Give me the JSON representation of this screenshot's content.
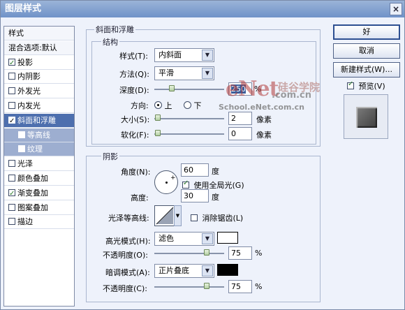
{
  "window": {
    "title": "图层样式",
    "close_glyph": "×"
  },
  "style_list": {
    "items": [
      {
        "label": "样式",
        "checkbox": false,
        "checked": false,
        "kind": "header"
      },
      {
        "label": "混合选项:默认",
        "checkbox": false,
        "checked": false,
        "kind": "header"
      },
      {
        "label": "投影",
        "checkbox": true,
        "checked": true,
        "kind": "item"
      },
      {
        "label": "内阴影",
        "checkbox": true,
        "checked": false,
        "kind": "item"
      },
      {
        "label": "外发光",
        "checkbox": true,
        "checked": false,
        "kind": "item"
      },
      {
        "label": "内发光",
        "checkbox": true,
        "checked": false,
        "kind": "item"
      },
      {
        "label": "斜面和浮雕",
        "checkbox": true,
        "checked": true,
        "kind": "selected"
      },
      {
        "label": "等高线",
        "checkbox": true,
        "checked": false,
        "kind": "sub"
      },
      {
        "label": "纹理",
        "checkbox": true,
        "checked": false,
        "kind": "sub"
      },
      {
        "label": "光泽",
        "checkbox": true,
        "checked": false,
        "kind": "item"
      },
      {
        "label": "颜色叠加",
        "checkbox": true,
        "checked": false,
        "kind": "item"
      },
      {
        "label": "渐变叠加",
        "checkbox": true,
        "checked": true,
        "kind": "item"
      },
      {
        "label": "图案叠加",
        "checkbox": true,
        "checked": false,
        "kind": "item"
      },
      {
        "label": "描边",
        "checkbox": true,
        "checked": false,
        "kind": "item"
      }
    ]
  },
  "bevel": {
    "group_title": "斜面和浮雕",
    "structure_title": "结构",
    "style_label": "样式(T):",
    "style_value": "内斜面",
    "method_label": "方法(Q):",
    "method_value": "平滑",
    "depth_label": "深度(D):",
    "depth_value": "250",
    "depth_unit": "%",
    "depth_level": 0.25,
    "direction_label": "方向:",
    "direction_up": "上",
    "direction_down": "下",
    "size_label": "大小(S):",
    "size_value": "2",
    "size_unit": "像素",
    "soften_label": "软化(F):",
    "soften_value": "0",
    "soften_unit": "像素"
  },
  "shading": {
    "title": "阴影",
    "angle_label": "角度(N):",
    "angle_value": "60",
    "angle_unit": "度",
    "global_light_label": "使用全局光(G)",
    "altitude_label": "高度:",
    "altitude_value": "30",
    "altitude_unit": "度",
    "gloss_label": "光泽等高线:",
    "antialias_label": "消除锯齿(L)",
    "highlight_label": "高光模式(H):",
    "highlight_mode": "滤色",
    "highlight_color": "#ffffff",
    "highlight_opacity_label": "不透明度(O):",
    "highlight_opacity": "75",
    "shadow_label": "暗调模式(A):",
    "shadow_mode": "正片叠底",
    "shadow_color": "#000000",
    "shadow_opacity_label": "不透明度(C):",
    "shadow_opacity": "75",
    "percent": "%",
    "crosshair_glyph": "+"
  },
  "buttons": {
    "ok": "好",
    "cancel": "取消",
    "new_style": "新建样式(W)...",
    "preview": "预览(V)"
  },
  "watermark": {
    "logo": "eNet",
    "sub": ".com.cn",
    "cn": "硅谷学院",
    "url": "School.eNet.com.cn"
  }
}
